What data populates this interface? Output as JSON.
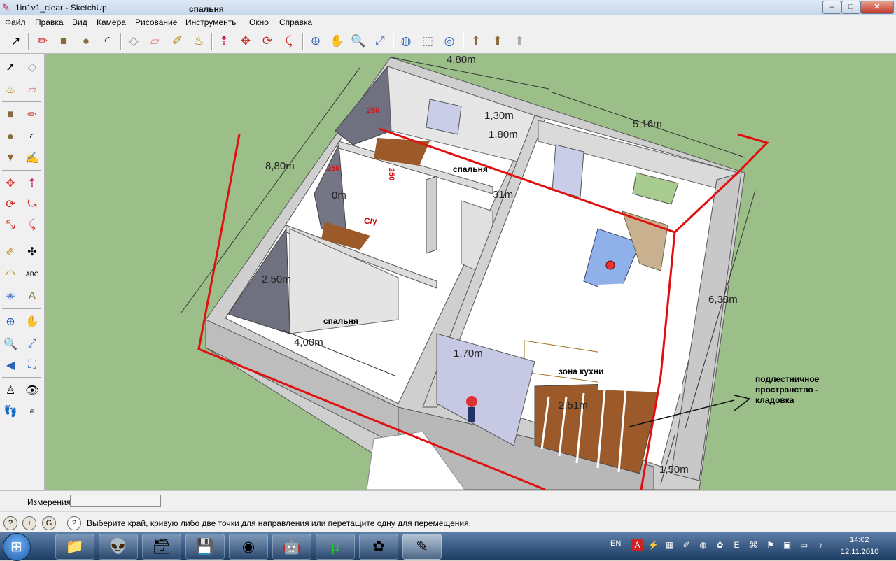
{
  "window": {
    "title": "1in1v1_clear - SketchUp",
    "title_overlay": "спальня",
    "min": "–",
    "max": "□",
    "close": "✕"
  },
  "menu": [
    "Файл",
    "Правка",
    "Вид",
    "Камера",
    "Рисование",
    "Инструменты",
    "Окно",
    "Справка"
  ],
  "model": {
    "dimensions": {
      "d1": "4,80m",
      "d2": "5,16m",
      "d3": "8,80m",
      "d4": "6,38m",
      "d5": "1,30m",
      "d6": "1,80m",
      "d7": "0m",
      "d8": "2,50m",
      "d9": "4,00m",
      "d10": "1,70m",
      "d11": "2,51m",
      "d12": "1,50m",
      "d13": "31m"
    },
    "labels": {
      "bedroom1": "спальня",
      "bedroom2": "спальня",
      "wc": "С/у",
      "kitchen": "зона кухни",
      "note": "подлестничное\nпространство -\nкладовка"
    },
    "red_marks": {
      "m1": "250",
      "m2": "250",
      "m3": "250"
    }
  },
  "measurements": {
    "label": "Измерения",
    "value": ""
  },
  "status": {
    "text": "Выберите край, кривую либо две точки для направления или перетащите одну для перемещения."
  },
  "taskbar": {
    "lang": "EN",
    "time": "14:02",
    "date": "12.11.2010"
  },
  "colors": {
    "viewport": "#9cbf8a",
    "redline": "#e01010",
    "wall": "#d8d8d8",
    "floor": "#ffffff"
  }
}
